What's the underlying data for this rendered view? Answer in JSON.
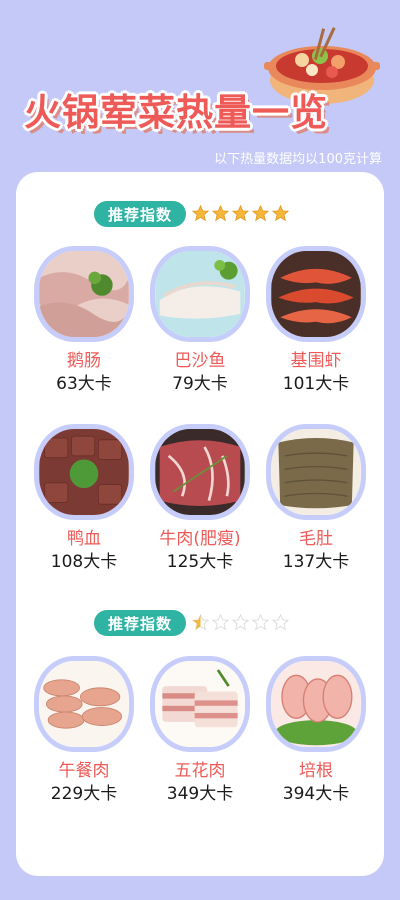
{
  "header": {
    "title": "火锅荤菜热量一览",
    "subtitle": "以下热量数据均以100克计算"
  },
  "sections": [
    {
      "badge": "推荐指数",
      "rating": 5,
      "items": [
        {
          "name": "鹅肠",
          "kcal": "63大卡",
          "image": "goose-intestine"
        },
        {
          "name": "巴沙鱼",
          "kcal": "79大卡",
          "image": "basa-fish"
        },
        {
          "name": "基围虾",
          "kcal": "101大卡",
          "image": "shrimp"
        },
        {
          "name": "鸭血",
          "kcal": "108大卡",
          "image": "duck-blood"
        },
        {
          "name": "牛肉(肥瘦)",
          "kcal": "125大卡",
          "image": "beef"
        },
        {
          "name": "毛肚",
          "kcal": "137大卡",
          "image": "tripe"
        }
      ]
    },
    {
      "badge": "推荐指数",
      "rating": 0.5,
      "items": [
        {
          "name": "午餐肉",
          "kcal": "229大卡",
          "image": "luncheon-meat"
        },
        {
          "name": "五花肉",
          "kcal": "349大卡",
          "image": "pork-belly"
        },
        {
          "name": "培根",
          "kcal": "394大卡",
          "image": "bacon"
        }
      ]
    }
  ],
  "colors": {
    "background": "#c5c9f7",
    "title": "#ee5a57",
    "badge": "#2fb3a2",
    "star": "#f5b63a",
    "photo_border": "#c7cdfa"
  }
}
